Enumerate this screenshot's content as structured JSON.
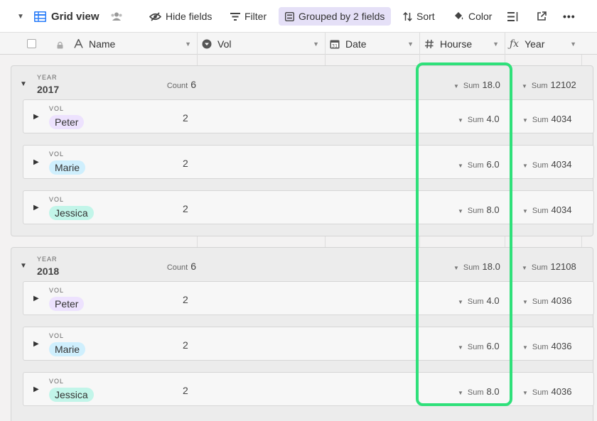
{
  "toolbar": {
    "view_name": "Grid view",
    "hide_fields": "Hide fields",
    "filter": "Filter",
    "grouped": "Grouped by 2 fields",
    "sort": "Sort",
    "color": "Color"
  },
  "columns": {
    "name": "Name",
    "vol": "Vol",
    "date": "Date",
    "hours": "Hourse",
    "year": "Year"
  },
  "labels": {
    "year_group": "YEAR",
    "vol_group": "VOL",
    "count": "Count",
    "sum": "Sum"
  },
  "groups": [
    {
      "year": "2017",
      "count": "6",
      "sum_hours": "18.0",
      "sum_year": "12102",
      "subgroups": [
        {
          "vol": "Peter",
          "count": "2",
          "sum_hours": "4.0",
          "sum_year": "4034"
        },
        {
          "vol": "Marie",
          "count": "2",
          "sum_hours": "6.0",
          "sum_year": "4034"
        },
        {
          "vol": "Jessica",
          "count": "2",
          "sum_hours": "8.0",
          "sum_year": "4034"
        }
      ]
    },
    {
      "year": "2018",
      "count": "6",
      "sum_hours": "18.0",
      "sum_year": "12108",
      "subgroups": [
        {
          "vol": "Peter",
          "count": "2",
          "sum_hours": "4.0",
          "sum_year": "4036"
        },
        {
          "vol": "Marie",
          "count": "2",
          "sum_hours": "6.0",
          "sum_year": "4036"
        },
        {
          "vol": "Jessica",
          "count": "2",
          "sum_hours": "8.0",
          "sum_year": "4036"
        }
      ]
    }
  ],
  "colors": {
    "pill_peter": "#ede2fe",
    "pill_marie": "#cfeffd",
    "pill_jessica": "#c2f5e9",
    "highlight": "#2fe07a",
    "grouped_bg": "#e5e0f7",
    "grid_icon": "#2d7ff9"
  }
}
